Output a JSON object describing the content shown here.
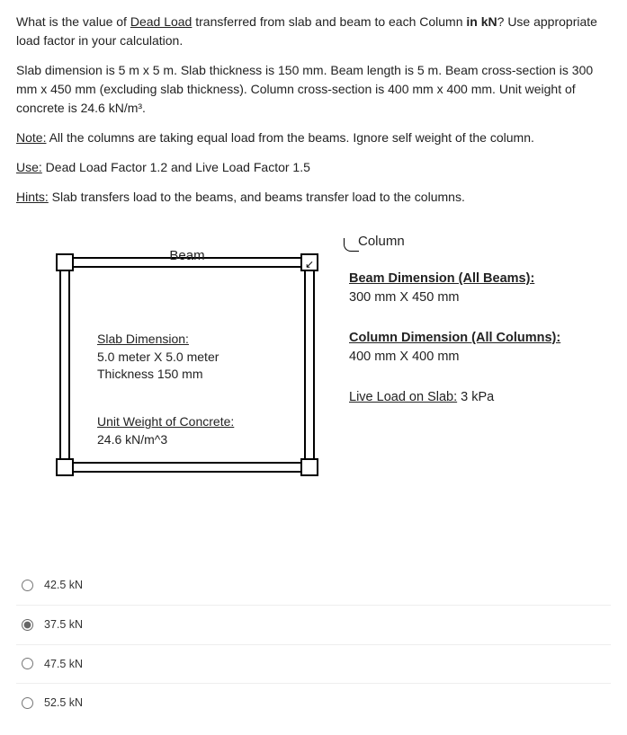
{
  "question": {
    "p1_a": "What is the value of ",
    "p1_u": "Dead Load",
    "p1_b": "  transferred from slab and beam to each Column ",
    "p1_bold": "in kN",
    "p1_c": "? Use appropriate load factor in your calculation.",
    "p2": "Slab dimension is 5 m x 5 m. Slab thickness is 150 mm. Beam length is 5 m. Beam cross-section is 300 mm x 450 mm (excluding slab thickness). Column cross-section is 400 mm x 400 mm. Unit weight of concrete is 24.6 kN/m³.",
    "p3_u": "Note:",
    "p3": " All the columns are taking equal load from the beams. Ignore self weight of the column.",
    "p4_u": "Use:",
    "p4": " Dead Load Factor 1.2 and Live Load Factor 1.5",
    "p5_u": "Hints:",
    "p5": " Slab transfers load to the beams, and beams transfer load to the columns."
  },
  "diagram": {
    "column_label": "Column",
    "beam_label": "Beam",
    "slab_title": "Slab Dimension:",
    "slab_line1": "5.0 meter X 5.0 meter",
    "slab_line2": "Thickness 150 mm",
    "uw_title": "Unit Weight of Concrete:",
    "uw_line1": "24.6 kN/m^3",
    "beamdim_title": "Beam Dimension (All Beams):",
    "beamdim_line1": "300 mm X 450 mm",
    "coldim_title": "Column Dimension (All Columns):",
    "coldim_line1": "400 mm X 400 mm",
    "live_title": "Live Load on Slab:",
    "live_val": " 3 kPa"
  },
  "options": {
    "a": "42.5 kN",
    "b": "37.5 kN",
    "c": "47.5 kN",
    "d": "52.5 kN",
    "selected": "b"
  }
}
